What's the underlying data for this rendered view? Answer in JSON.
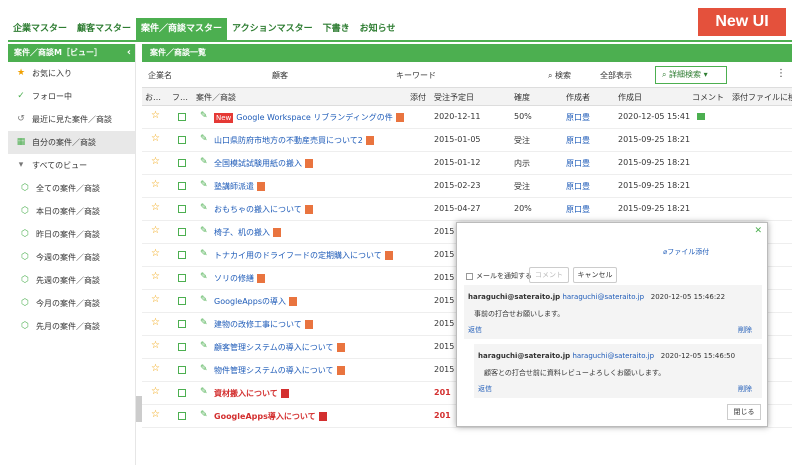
{
  "topnav": {
    "tabs": [
      "企業マスター",
      "顧客マスター",
      "案件／商談マスター",
      "アクションマスター",
      "下書き",
      "お知らせ"
    ],
    "active_index": 2,
    "new_ui": "New UI"
  },
  "sidebar": {
    "header": "案件／商談M［ビュー］",
    "collapse_icon": "‹",
    "items": [
      {
        "label": "お気に入り",
        "icon": "star-icon"
      },
      {
        "label": "フォロー中",
        "icon": "check-icon"
      },
      {
        "label": "最近に見た案件／商談",
        "icon": "history-icon"
      },
      {
        "label": "自分の案件／商談",
        "icon": "grid-icon"
      },
      {
        "label": "すべてのビュー",
        "icon": "chevron-down-icon"
      },
      {
        "label": "全ての案件／商談",
        "icon": "cube-icon"
      },
      {
        "label": "本日の案件／商談",
        "icon": "cube-icon"
      },
      {
        "label": "昨日の案件／商談",
        "icon": "cube-icon"
      },
      {
        "label": "今週の案件／商談",
        "icon": "cube-icon"
      },
      {
        "label": "先週の案件／商談",
        "icon": "cube-icon"
      },
      {
        "label": "今月の案件／商談",
        "icon": "cube-icon"
      },
      {
        "label": "先月の案件／商談",
        "icon": "cube-icon"
      }
    ]
  },
  "main": {
    "header": "案件／商談一覧",
    "search": {
      "company_label": "企業名",
      "customer_label": "顧客",
      "keyword_label": "キーワード",
      "search_btn": "検索",
      "show_all_btn": "全部表示",
      "advanced_btn": "詳細検索"
    },
    "columns": [
      "お…",
      "フ…",
      "案件／商談",
      "添付",
      "受注予定日",
      "確度",
      "作成者",
      "作成日",
      "コメント",
      "添付ファイルに検"
    ],
    "rows": [
      {
        "title": "Google Workspace リブランディングの件",
        "new": "New",
        "due": "2020-12-11",
        "prob": "50%",
        "creator": "原口豊",
        "created": "2020-12-05 15:41",
        "comment": true,
        "red": false
      },
      {
        "title": "山口県防府市地方の不動産売買について2",
        "due": "2015-01-05",
        "prob": "受注",
        "creator": "原口豊",
        "created": "2015-09-25 18:21",
        "red": false
      },
      {
        "title": "全国模試試験用紙の搬入",
        "due": "2015-01-12",
        "prob": "内示",
        "creator": "原口豊",
        "created": "2015-09-25 18:21",
        "red": false
      },
      {
        "title": "塾講師派遣",
        "due": "2015-02-23",
        "prob": "受注",
        "creator": "原口豊",
        "created": "2015-09-25 18:21",
        "red": false
      },
      {
        "title": "おもちゃの搬入について",
        "due": "2015-04-27",
        "prob": "20%",
        "creator": "原口豊",
        "created": "2015-09-25 18:21",
        "red": false
      },
      {
        "title": "椅子、机の搬入",
        "due": "2015",
        "red": false
      },
      {
        "title": "トナカイ用のドライフードの定期購入について",
        "due": "2015",
        "red": false
      },
      {
        "title": "ソリの修繕",
        "due": "2015",
        "red": false
      },
      {
        "title": "GoogleAppsの導入",
        "due": "2015",
        "red": false
      },
      {
        "title": "建物の改修工事について",
        "due": "2015",
        "red": false
      },
      {
        "title": "顧客管理システムの導入について",
        "due": "2015",
        "red": false
      },
      {
        "title": "物件管理システムの導入について",
        "due": "2015",
        "red": false
      },
      {
        "title": "資材搬入について",
        "due": "201",
        "red": true
      },
      {
        "title": "GoogleApps導入について",
        "due": "201",
        "red": true
      }
    ]
  },
  "popup": {
    "attach_link": "ファイル添付",
    "notify_label": "メールを通知する",
    "comment_btn": "コメント",
    "cancel_btn": "キャンセル",
    "comments": [
      {
        "user": "haraguchi@sateraito.jp",
        "email": "haraguchi@sateraito.jp",
        "date": "2020-12-05 15:46:22",
        "message": "事前の打合せお願いします。",
        "reply": "返信",
        "delete": "削除"
      },
      {
        "user": "haraguchi@sateraito.jp",
        "email": "haraguchi@sateraito.jp",
        "date": "2020-12-05 15:46:50",
        "message": "顧客との打合せ前に資料レビューよろしくお願いします。",
        "reply": "返信",
        "delete": "削除"
      }
    ],
    "close_btn": "閉じる"
  },
  "colors": {
    "accent": "#4caf50",
    "new_ui": "#e4513c",
    "link": "#1e5bb8",
    "red": "#d32f2f"
  }
}
